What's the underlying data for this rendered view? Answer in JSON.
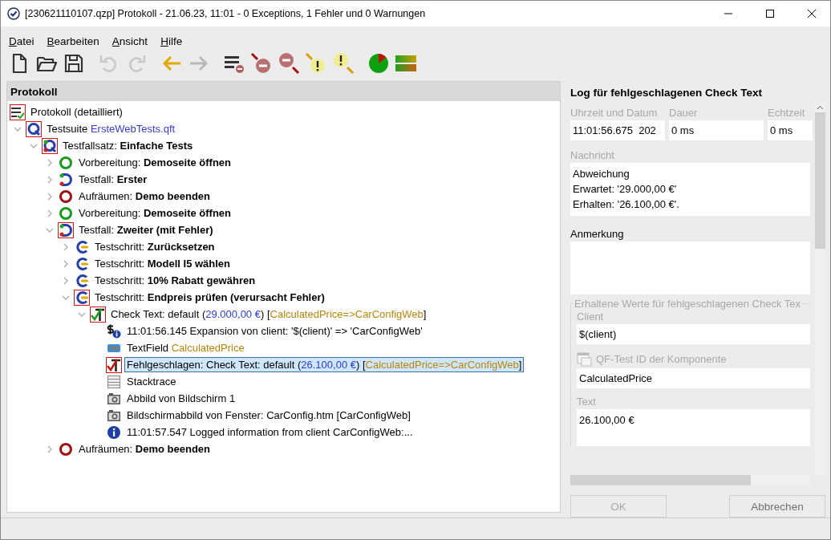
{
  "window": {
    "title": "[230621110107.qzp] Protokoll - 21.06.23, 11:01 - 0 Exceptions, 1 Fehler und 0 Warnungen"
  },
  "menu": [
    {
      "label": "Datei"
    },
    {
      "label": "Bearbeiten"
    },
    {
      "label": "Ansicht"
    },
    {
      "label": "Hilfe"
    }
  ],
  "toolbar_groups": [
    {
      "buttons": [
        {
          "kind": "new"
        },
        {
          "kind": "open"
        },
        {
          "kind": "save"
        }
      ]
    },
    {
      "buttons": [
        {
          "kind": "undo",
          "disabled": true
        },
        {
          "kind": "redo",
          "disabled": true
        }
      ]
    },
    {
      "buttons": [
        {
          "kind": "back"
        },
        {
          "kind": "forward",
          "disabled": true
        }
      ]
    },
    {
      "buttons": [
        {
          "kind": "filter"
        },
        {
          "kind": "errorup"
        },
        {
          "kind": "errordown"
        },
        {
          "kind": "warnup"
        },
        {
          "kind": "warndown"
        }
      ]
    },
    {
      "buttons": [
        {
          "kind": "pie"
        },
        {
          "kind": "bars"
        }
      ]
    }
  ],
  "tree_panel": {
    "title": "Protokoll"
  },
  "tree": [
    {
      "kind": "log",
      "flagged": true,
      "selected": false,
      "segments": [
        {
          "kind": "plain",
          "text": "Protokoll (detailliert)"
        }
      ],
      "children": [
        {
          "kind": "suite",
          "flagged": true,
          "selected": false,
          "expanded": true,
          "segments": [
            {
              "kind": "plain",
              "text": "Testsuite "
            },
            {
              "kind": "link",
              "text": "ErsteWebTests.qft"
            }
          ],
          "children": [
            {
              "kind": "testset",
              "flagged": true,
              "selected": false,
              "expanded": true,
              "segments": [
                {
                  "kind": "plain",
                  "text": "Testfallsatz: "
                },
                {
                  "kind": "bold",
                  "text": "Einfache Tests"
                }
              ],
              "children": [
                {
                  "kind": "prep",
                  "flagged": false,
                  "selected": false,
                  "expanded": false,
                  "segments": [
                    {
                      "kind": "plain",
                      "text": "Vorbereitung: "
                    },
                    {
                      "kind": "bold",
                      "text": "Demoseite öffnen"
                    }
                  ]
                },
                {
                  "kind": "testcase",
                  "flagged": false,
                  "selected": false,
                  "expanded": false,
                  "segments": [
                    {
                      "kind": "plain",
                      "text": "Testfall: "
                    },
                    {
                      "kind": "bold",
                      "text": "Erster"
                    }
                  ]
                },
                {
                  "kind": "cleanup",
                  "flagged": false,
                  "selected": false,
                  "expanded": false,
                  "segments": [
                    {
                      "kind": "plain",
                      "text": "Aufräumen: "
                    },
                    {
                      "kind": "bold",
                      "text": "Demo beenden"
                    }
                  ]
                },
                {
                  "kind": "prep",
                  "flagged": false,
                  "selected": false,
                  "expanded": false,
                  "segments": [
                    {
                      "kind": "plain",
                      "text": "Vorbereitung: "
                    },
                    {
                      "kind": "bold",
                      "text": "Demoseite öffnen"
                    }
                  ]
                },
                {
                  "kind": "testcase",
                  "flagged": true,
                  "selected": false,
                  "expanded": true,
                  "segments": [
                    {
                      "kind": "plain",
                      "text": "Testfall: "
                    },
                    {
                      "kind": "bold",
                      "text": "Zweiter (mit Fehler)"
                    }
                  ],
                  "children": [
                    {
                      "kind": "step",
                      "flagged": false,
                      "selected": false,
                      "expanded": false,
                      "segments": [
                        {
                          "kind": "plain",
                          "text": "Testschritt: "
                        },
                        {
                          "kind": "bold",
                          "text": "Zurücksetzen"
                        }
                      ]
                    },
                    {
                      "kind": "step",
                      "flagged": false,
                      "selected": false,
                      "expanded": false,
                      "segments": [
                        {
                          "kind": "plain",
                          "text": "Testschritt: "
                        },
                        {
                          "kind": "bold",
                          "text": "Modell I5 wählen"
                        }
                      ]
                    },
                    {
                      "kind": "step",
                      "flagged": false,
                      "selected": false,
                      "expanded": false,
                      "segments": [
                        {
                          "kind": "plain",
                          "text": "Testschritt: "
                        },
                        {
                          "kind": "bold",
                          "text": "10% Rabatt gewähren"
                        }
                      ]
                    },
                    {
                      "kind": "step",
                      "flagged": true,
                      "selected": false,
                      "expanded": true,
                      "segments": [
                        {
                          "kind": "plain",
                          "text": "Testschritt: "
                        },
                        {
                          "kind": "bold",
                          "text": "Endpreis prüfen (verursacht Fehler)"
                        }
                      ],
                      "children": [
                        {
                          "kind": "checkok",
                          "flagged": true,
                          "selected": false,
                          "expanded": true,
                          "segments": [
                            {
                              "kind": "plain",
                              "text": "Check Text: default ("
                            },
                            {
                              "kind": "value",
                              "text": "29.000,00 €"
                            },
                            {
                              "kind": "plain",
                              "text": ") ["
                            },
                            {
                              "kind": "component",
                              "text": "CalculatedPrice=>CarConfigWeb"
                            },
                            {
                              "kind": "plain",
                              "text": "]"
                            }
                          ],
                          "children": [
                            {
                              "kind": "expansion",
                              "flagged": false,
                              "selected": false,
                              "segments": [
                                {
                                  "kind": "plain",
                                  "text": "11:01:56.145 Expansion von client: '$(client)' => 'CarConfigWeb'"
                                }
                              ]
                            },
                            {
                              "kind": "textfield",
                              "flagged": false,
                              "selected": false,
                              "segments": [
                                {
                                  "kind": "plain",
                                  "text": "TextField "
                                },
                                {
                                  "kind": "component",
                                  "text": "CalculatedPrice"
                                }
                              ]
                            },
                            {
                              "kind": "checkfail",
                              "flagged": true,
                              "selected": true,
                              "segments": [
                                {
                                  "kind": "plain",
                                  "text": "Fehlgeschlagen: Check Text: default ("
                                },
                                {
                                  "kind": "value",
                                  "text": "26.100,00 €"
                                },
                                {
                                  "kind": "plain",
                                  "text": ") ["
                                },
                                {
                                  "kind": "component",
                                  "text": "CalculatedPrice=>CarConfigWeb"
                                },
                                {
                                  "kind": "plain",
                                  "text": "]"
                                }
                              ]
                            },
                            {
                              "kind": "stacktrace",
                              "flagged": false,
                              "selected": false,
                              "segments": [
                                {
                                  "kind": "plain",
                                  "text": "Stacktrace"
                                }
                              ]
                            },
                            {
                              "kind": "screenshot",
                              "flagged": false,
                              "selected": false,
                              "segments": [
                                {
                                  "kind": "plain",
                                  "text": "Abbild von Bildschirm 1"
                                }
                              ]
                            },
                            {
                              "kind": "screenshot",
                              "flagged": false,
                              "selected": false,
                              "segments": [
                                {
                                  "kind": "plain",
                                  "text": "Bildschirmabbild von Fenster: CarConfig.htm [CarConfigWeb]"
                                }
                              ]
                            },
                            {
                              "kind": "info",
                              "flagged": false,
                              "selected": false,
                              "segments": [
                                {
                                  "kind": "plain",
                                  "text": "11:01:57.547 Logged information from client CarConfigWeb:..."
                                }
                              ]
                            }
                          ]
                        }
                      ]
                    }
                  ]
                },
                {
                  "kind": "cleanup",
                  "flagged": false,
                  "selected": false,
                  "expanded": false,
                  "segments": [
                    {
                      "kind": "plain",
                      "text": "Aufräumen: "
                    },
                    {
                      "kind": "bold",
                      "text": "Demo beenden"
                    }
                  ]
                }
              ]
            }
          ]
        }
      ]
    }
  ],
  "details": {
    "title": "Log für fehlgeschlagenen Check Text",
    "top_fields": [
      {
        "label": "Uhrzeit und Datum",
        "value": "11:01:56.675  202",
        "disabled": true
      },
      {
        "label": "Dauer",
        "value": "0 ms",
        "disabled": true
      },
      {
        "label": "Echtzeit",
        "value": "0 ms",
        "disabled": true
      }
    ],
    "message": {
      "label": "Nachricht",
      "disabled": true,
      "lines": [
        "Abweichung",
        "Erwartet: '29.000,00 €'",
        "Erhalten: '26.100,00 €'."
      ]
    },
    "note": {
      "label": "Anmerkung",
      "disabled": false
    },
    "group": {
      "legend": "Erhaltene Werte für fehlgeschlagenen Check Tex",
      "fields": [
        {
          "kind": "line",
          "label": "Client",
          "value": "$(client)"
        },
        {
          "kind": "component",
          "label": "QF-Test ID der Komponente",
          "value": "CalculatedPrice"
        },
        {
          "kind": "area",
          "label": "Text",
          "value": "26.100,00 €"
        }
      ]
    },
    "buttons": [
      {
        "label": "OK",
        "disabled": true
      },
      {
        "label": "Abbrechen",
        "disabled": false
      }
    ]
  }
}
